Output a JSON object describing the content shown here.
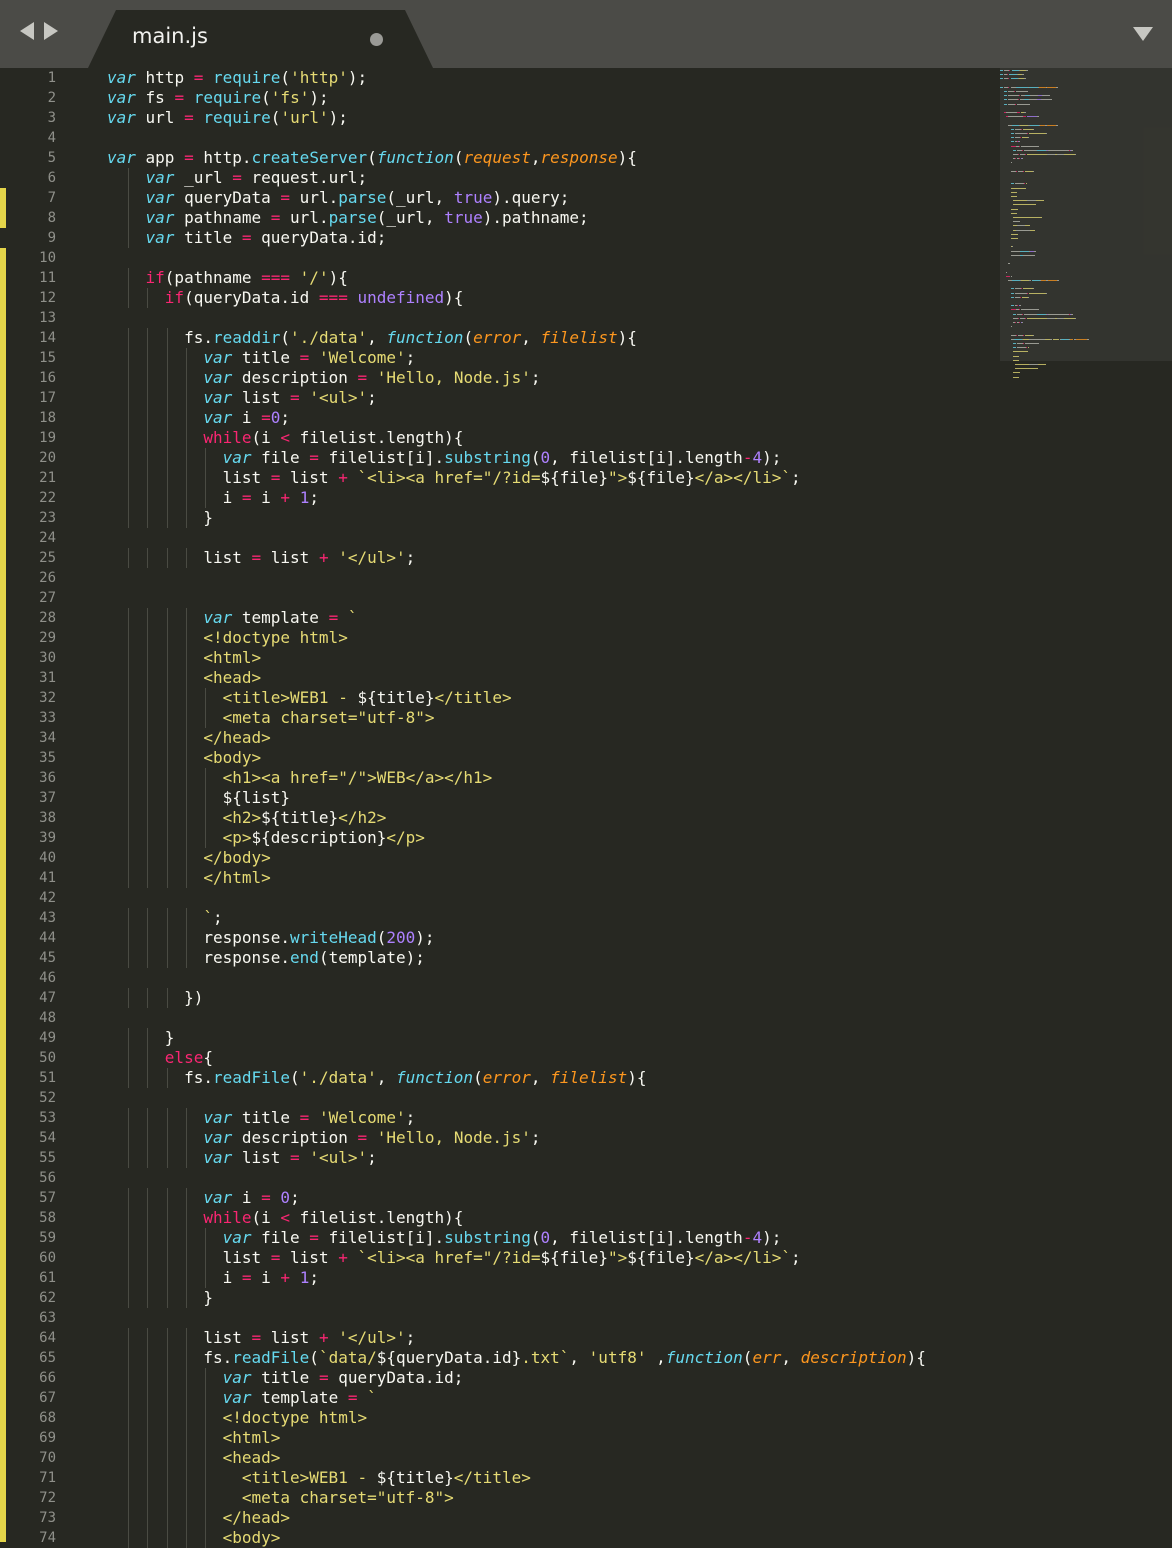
{
  "tab": {
    "filename": "main.js",
    "modified_indicator": "dot"
  },
  "nav": {
    "back_icon": "arrow-left-icon",
    "forward_icon": "arrow-right-icon",
    "menu_icon": "chevron-down-icon"
  },
  "theme": {
    "background": "#272822",
    "text": "#f8f8f2",
    "keyword_storage": "#66d9ef",
    "keyword_control": "#f92672",
    "string": "#e6db74",
    "number": "#ae81ff",
    "parameter": "#fd971f",
    "gutter_marker": "#e4d54a"
  },
  "lines": [
    [
      [
        "k",
        "var"
      ],
      [
        "t",
        " http "
      ],
      [
        "o",
        "="
      ],
      [
        "t",
        " "
      ],
      [
        "f",
        "require"
      ],
      [
        "t",
        "("
      ],
      [
        "s",
        "'http'"
      ],
      [
        "t",
        ");"
      ]
    ],
    [
      [
        "k",
        "var"
      ],
      [
        "t",
        " fs "
      ],
      [
        "o",
        "="
      ],
      [
        "t",
        " "
      ],
      [
        "f",
        "require"
      ],
      [
        "t",
        "("
      ],
      [
        "s",
        "'fs'"
      ],
      [
        "t",
        ");"
      ]
    ],
    [
      [
        "k",
        "var"
      ],
      [
        "t",
        " url "
      ],
      [
        "o",
        "="
      ],
      [
        "t",
        " "
      ],
      [
        "f",
        "require"
      ],
      [
        "t",
        "("
      ],
      [
        "s",
        "'url'"
      ],
      [
        "t",
        ");"
      ]
    ],
    [],
    [
      [
        "k",
        "var"
      ],
      [
        "t",
        " app "
      ],
      [
        "o",
        "="
      ],
      [
        "t",
        " http."
      ],
      [
        "f",
        "createServer"
      ],
      [
        "t",
        "("
      ],
      [
        "k",
        "function"
      ],
      [
        "t",
        "("
      ],
      [
        "p",
        "request"
      ],
      [
        "t",
        ","
      ],
      [
        "p",
        "response"
      ],
      [
        "t",
        "){"
      ]
    ],
    [
      [
        "t",
        "    "
      ],
      [
        "k",
        "var"
      ],
      [
        "t",
        " _url "
      ],
      [
        "o",
        "="
      ],
      [
        "t",
        " request.url;"
      ]
    ],
    [
      [
        "t",
        "    "
      ],
      [
        "k",
        "var"
      ],
      [
        "t",
        " queryData "
      ],
      [
        "o",
        "="
      ],
      [
        "t",
        " url."
      ],
      [
        "f",
        "parse"
      ],
      [
        "t",
        "(_url, "
      ],
      [
        "n",
        "true"
      ],
      [
        "t",
        ").query;"
      ]
    ],
    [
      [
        "t",
        "    "
      ],
      [
        "k",
        "var"
      ],
      [
        "t",
        " pathname "
      ],
      [
        "o",
        "="
      ],
      [
        "t",
        " url."
      ],
      [
        "f",
        "parse"
      ],
      [
        "t",
        "(_url, "
      ],
      [
        "n",
        "true"
      ],
      [
        "t",
        ").pathname;"
      ]
    ],
    [
      [
        "t",
        "    "
      ],
      [
        "k",
        "var"
      ],
      [
        "t",
        " title "
      ],
      [
        "o",
        "="
      ],
      [
        "t",
        " queryData.id;"
      ]
    ],
    [],
    [
      [
        "t",
        "    "
      ],
      [
        "kw",
        "if"
      ],
      [
        "t",
        "(pathname "
      ],
      [
        "o",
        "==="
      ],
      [
        "t",
        " "
      ],
      [
        "s",
        "'/'"
      ],
      [
        "t",
        "){"
      ]
    ],
    [
      [
        "t",
        "      "
      ],
      [
        "kw",
        "if"
      ],
      [
        "t",
        "(queryData.id "
      ],
      [
        "o",
        "==="
      ],
      [
        "t",
        " "
      ],
      [
        "n",
        "undefined"
      ],
      [
        "t",
        "){"
      ]
    ],
    [],
    [
      [
        "t",
        "        fs."
      ],
      [
        "f",
        "readdir"
      ],
      [
        "t",
        "("
      ],
      [
        "s",
        "'./data'"
      ],
      [
        "t",
        ", "
      ],
      [
        "k",
        "function"
      ],
      [
        "t",
        "("
      ],
      [
        "p",
        "error"
      ],
      [
        "t",
        ", "
      ],
      [
        "p",
        "filelist"
      ],
      [
        "t",
        "){"
      ]
    ],
    [
      [
        "t",
        "          "
      ],
      [
        "k",
        "var"
      ],
      [
        "t",
        " title "
      ],
      [
        "o",
        "="
      ],
      [
        "t",
        " "
      ],
      [
        "s",
        "'Welcome'"
      ],
      [
        "t",
        ";"
      ]
    ],
    [
      [
        "t",
        "          "
      ],
      [
        "k",
        "var"
      ],
      [
        "t",
        " description "
      ],
      [
        "o",
        "="
      ],
      [
        "t",
        " "
      ],
      [
        "s",
        "'Hello, Node.js'"
      ],
      [
        "t",
        ";"
      ]
    ],
    [
      [
        "t",
        "          "
      ],
      [
        "k",
        "var"
      ],
      [
        "t",
        " list "
      ],
      [
        "o",
        "="
      ],
      [
        "t",
        " "
      ],
      [
        "s",
        "'<ul>'"
      ],
      [
        "t",
        ";"
      ]
    ],
    [
      [
        "t",
        "          "
      ],
      [
        "k",
        "var"
      ],
      [
        "t",
        " i "
      ],
      [
        "o",
        "="
      ],
      [
        "n",
        "0"
      ],
      [
        "t",
        ";"
      ]
    ],
    [
      [
        "t",
        "          "
      ],
      [
        "kw",
        "while"
      ],
      [
        "t",
        "(i "
      ],
      [
        "o",
        "<"
      ],
      [
        "t",
        " filelist.length){"
      ]
    ],
    [
      [
        "t",
        "            "
      ],
      [
        "k",
        "var"
      ],
      [
        "t",
        " file "
      ],
      [
        "o",
        "="
      ],
      [
        "t",
        " filelist[i]."
      ],
      [
        "f",
        "substring"
      ],
      [
        "t",
        "("
      ],
      [
        "n",
        "0"
      ],
      [
        "t",
        ", filelist[i].length"
      ],
      [
        "o",
        "-"
      ],
      [
        "n",
        "4"
      ],
      [
        "t",
        ");"
      ]
    ],
    [
      [
        "t",
        "            list "
      ],
      [
        "o",
        "="
      ],
      [
        "t",
        " list "
      ],
      [
        "o",
        "+"
      ],
      [
        "t",
        " "
      ],
      [
        "s",
        "`<li><a href=\"/?id="
      ],
      [
        "t",
        "${file}"
      ],
      [
        "s",
        "\">"
      ],
      [
        "t",
        "${file}"
      ],
      [
        "s",
        "</a></li>`"
      ],
      [
        "t",
        ";"
      ]
    ],
    [
      [
        "t",
        "            i "
      ],
      [
        "o",
        "="
      ],
      [
        "t",
        " i "
      ],
      [
        "o",
        "+"
      ],
      [
        "t",
        " "
      ],
      [
        "n",
        "1"
      ],
      [
        "t",
        ";"
      ]
    ],
    [
      [
        "t",
        "          }"
      ]
    ],
    [],
    [
      [
        "t",
        "          list "
      ],
      [
        "o",
        "="
      ],
      [
        "t",
        " list "
      ],
      [
        "o",
        "+"
      ],
      [
        "t",
        " "
      ],
      [
        "s",
        "'</ul>'"
      ],
      [
        "t",
        ";"
      ]
    ],
    [],
    [],
    [
      [
        "t",
        "          "
      ],
      [
        "k",
        "var"
      ],
      [
        "t",
        " template "
      ],
      [
        "o",
        "="
      ],
      [
        "t",
        " "
      ],
      [
        "s",
        "`"
      ]
    ],
    [
      [
        "s",
        "          <!doctype html>"
      ]
    ],
    [
      [
        "s",
        "          <html>"
      ]
    ],
    [
      [
        "s",
        "          <head>"
      ]
    ],
    [
      [
        "s",
        "            <title>WEB1 - "
      ],
      [
        "t",
        "${title}"
      ],
      [
        "s",
        "</title>"
      ]
    ],
    [
      [
        "s",
        "            <meta charset=\"utf-8\">"
      ]
    ],
    [
      [
        "s",
        "          </head>"
      ]
    ],
    [
      [
        "s",
        "          <body>"
      ]
    ],
    [
      [
        "s",
        "            <h1><a href=\"/\">WEB</a></h1>"
      ]
    ],
    [
      [
        "t",
        "            ${list}"
      ]
    ],
    [
      [
        "s",
        "            <h2>"
      ],
      [
        "t",
        "${title}"
      ],
      [
        "s",
        "</h2>"
      ]
    ],
    [
      [
        "s",
        "            <p>"
      ],
      [
        "t",
        "${description}"
      ],
      [
        "s",
        "</p>"
      ]
    ],
    [
      [
        "s",
        "          </body>"
      ]
    ],
    [
      [
        "s",
        "          </html>"
      ]
    ],
    [],
    [
      [
        "s",
        "          `"
      ],
      [
        "t",
        ";"
      ]
    ],
    [
      [
        "t",
        "          response."
      ],
      [
        "f",
        "writeHead"
      ],
      [
        "t",
        "("
      ],
      [
        "n",
        "200"
      ],
      [
        "t",
        ");"
      ]
    ],
    [
      [
        "t",
        "          response."
      ],
      [
        "f",
        "end"
      ],
      [
        "t",
        "(template);"
      ]
    ],
    [],
    [
      [
        "t",
        "        })"
      ]
    ],
    [],
    [
      [
        "t",
        "      }"
      ]
    ],
    [
      [
        "t",
        "      "
      ],
      [
        "kw",
        "else"
      ],
      [
        "t",
        "{"
      ]
    ],
    [
      [
        "t",
        "        fs."
      ],
      [
        "f",
        "readFile"
      ],
      [
        "t",
        "("
      ],
      [
        "s",
        "'./data'"
      ],
      [
        "t",
        ", "
      ],
      [
        "k",
        "function"
      ],
      [
        "t",
        "("
      ],
      [
        "p",
        "error"
      ],
      [
        "t",
        ", "
      ],
      [
        "p",
        "filelist"
      ],
      [
        "t",
        "){"
      ]
    ],
    [],
    [
      [
        "t",
        "          "
      ],
      [
        "k",
        "var"
      ],
      [
        "t",
        " title "
      ],
      [
        "o",
        "="
      ],
      [
        "t",
        " "
      ],
      [
        "s",
        "'Welcome'"
      ],
      [
        "t",
        ";"
      ]
    ],
    [
      [
        "t",
        "          "
      ],
      [
        "k",
        "var"
      ],
      [
        "t",
        " description "
      ],
      [
        "o",
        "="
      ],
      [
        "t",
        " "
      ],
      [
        "s",
        "'Hello, Node.js'"
      ],
      [
        "t",
        ";"
      ]
    ],
    [
      [
        "t",
        "          "
      ],
      [
        "k",
        "var"
      ],
      [
        "t",
        " list "
      ],
      [
        "o",
        "="
      ],
      [
        "t",
        " "
      ],
      [
        "s",
        "'<ul>'"
      ],
      [
        "t",
        ";"
      ]
    ],
    [],
    [
      [
        "t",
        "          "
      ],
      [
        "k",
        "var"
      ],
      [
        "t",
        " i "
      ],
      [
        "o",
        "="
      ],
      [
        "t",
        " "
      ],
      [
        "n",
        "0"
      ],
      [
        "t",
        ";"
      ]
    ],
    [
      [
        "t",
        "          "
      ],
      [
        "kw",
        "while"
      ],
      [
        "t",
        "(i "
      ],
      [
        "o",
        "<"
      ],
      [
        "t",
        " filelist.length){"
      ]
    ],
    [
      [
        "t",
        "            "
      ],
      [
        "k",
        "var"
      ],
      [
        "t",
        " file "
      ],
      [
        "o",
        "="
      ],
      [
        "t",
        " filelist[i]."
      ],
      [
        "f",
        "substring"
      ],
      [
        "t",
        "("
      ],
      [
        "n",
        "0"
      ],
      [
        "t",
        ", filelist[i].length"
      ],
      [
        "o",
        "-"
      ],
      [
        "n",
        "4"
      ],
      [
        "t",
        ");"
      ]
    ],
    [
      [
        "t",
        "            list "
      ],
      [
        "o",
        "="
      ],
      [
        "t",
        " list "
      ],
      [
        "o",
        "+"
      ],
      [
        "t",
        " "
      ],
      [
        "s",
        "`<li><a href=\"/?id="
      ],
      [
        "t",
        "${file}"
      ],
      [
        "s",
        "\">"
      ],
      [
        "t",
        "${file}"
      ],
      [
        "s",
        "</a></li>`"
      ],
      [
        "t",
        ";"
      ]
    ],
    [
      [
        "t",
        "            i "
      ],
      [
        "o",
        "="
      ],
      [
        "t",
        " i "
      ],
      [
        "o",
        "+"
      ],
      [
        "t",
        " "
      ],
      [
        "n",
        "1"
      ],
      [
        "t",
        ";"
      ]
    ],
    [
      [
        "t",
        "          }"
      ]
    ],
    [],
    [
      [
        "t",
        "          list "
      ],
      [
        "o",
        "="
      ],
      [
        "t",
        " list "
      ],
      [
        "o",
        "+"
      ],
      [
        "t",
        " "
      ],
      [
        "s",
        "'</ul>'"
      ],
      [
        "t",
        ";"
      ]
    ],
    [
      [
        "t",
        "          fs."
      ],
      [
        "f",
        "readFile"
      ],
      [
        "t",
        "("
      ],
      [
        "s",
        "`data/"
      ],
      [
        "t",
        "${queryData.id}"
      ],
      [
        "s",
        ".txt`"
      ],
      [
        "t",
        ", "
      ],
      [
        "s",
        "'utf8'"
      ],
      [
        "t",
        " ,"
      ],
      [
        "k",
        "function"
      ],
      [
        "t",
        "("
      ],
      [
        "p",
        "err"
      ],
      [
        "t",
        ", "
      ],
      [
        "p",
        "description"
      ],
      [
        "t",
        "){"
      ]
    ],
    [
      [
        "t",
        "            "
      ],
      [
        "k",
        "var"
      ],
      [
        "t",
        " title "
      ],
      [
        "o",
        "="
      ],
      [
        "t",
        " queryData.id;"
      ]
    ],
    [
      [
        "t",
        "            "
      ],
      [
        "k",
        "var"
      ],
      [
        "t",
        " template "
      ],
      [
        "o",
        "="
      ],
      [
        "t",
        " "
      ],
      [
        "s",
        "`"
      ]
    ],
    [
      [
        "s",
        "            <!doctype html>"
      ]
    ],
    [
      [
        "s",
        "            <html>"
      ]
    ],
    [
      [
        "s",
        "            <head>"
      ]
    ],
    [
      [
        "s",
        "              <title>WEB1 - "
      ],
      [
        "t",
        "${title}"
      ],
      [
        "s",
        "</title>"
      ]
    ],
    [
      [
        "s",
        "              <meta charset=\"utf-8\">"
      ]
    ],
    [
      [
        "s",
        "            </head>"
      ]
    ],
    [
      [
        "s",
        "            <body>"
      ]
    ]
  ]
}
